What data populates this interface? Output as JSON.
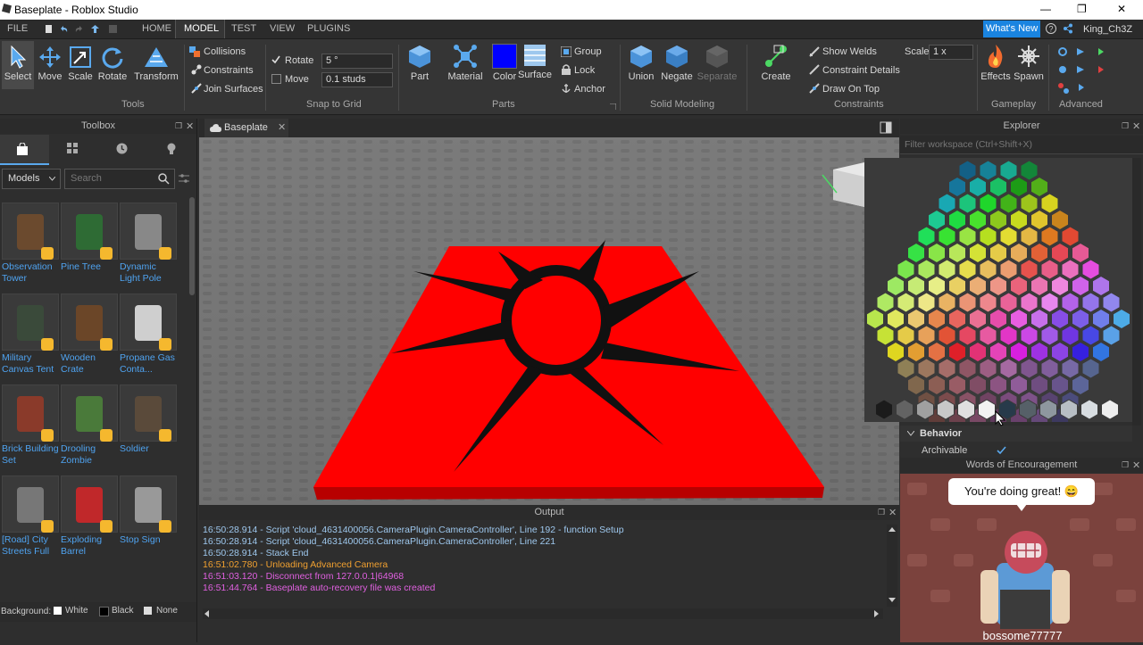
{
  "window": {
    "title": "Baseplate - Roblox Studio",
    "controls": [
      "—",
      "❐",
      "✕"
    ]
  },
  "menu": {
    "tabs": [
      "FILE",
      "HOME",
      "MODEL",
      "TEST",
      "VIEW",
      "PLUGINS"
    ],
    "active": "MODEL",
    "whats_new": "What's New",
    "username": "King_Ch3Z"
  },
  "ribbon": {
    "tools": {
      "items": [
        "Select",
        "Move",
        "Scale",
        "Rotate",
        "Transform"
      ],
      "group": "Tools"
    },
    "collisions": {
      "items": [
        "Collisions",
        "Constraints",
        "Join Surfaces"
      ]
    },
    "snap": {
      "rotate_label": "Rotate",
      "rotate_value": "5 °",
      "move_label": "Move",
      "move_value": "0.1 studs",
      "group": "Snap to Grid"
    },
    "parts": {
      "items": [
        "Part",
        "Material",
        "Color",
        "Surface"
      ],
      "group": "Parts",
      "color_hex": "#0000ff"
    },
    "group_lock": {
      "items": [
        "Group",
        "Lock",
        "Anchor"
      ]
    },
    "solid": {
      "items": [
        "Union",
        "Negate",
        "Separate"
      ],
      "group": "Solid Modeling"
    },
    "create": {
      "label": "Create"
    },
    "constraints": {
      "items": [
        "Show Welds",
        "Constraint Details",
        "Draw On Top"
      ],
      "scale_label": "Scale",
      "scale_value": "1 x",
      "group": "Constraints"
    },
    "gameplay": {
      "items": [
        "Effects",
        "Spawn"
      ],
      "group": "Gameplay"
    },
    "advanced": {
      "group": "Advanced"
    }
  },
  "toolbox": {
    "title": "Toolbox",
    "category": "Models",
    "search_placeholder": "Search",
    "models": [
      "Observation Tower",
      "Pine Tree",
      "Dynamic Light Pole",
      "Military Canvas Tent",
      "Wooden Crate",
      "Propane Gas Conta...",
      "Brick Building Set",
      "Drooling Zombie",
      "Soldier",
      "[Road] City Streets Full",
      "Exploding Barrel",
      "Stop Sign"
    ],
    "background_label": "Background:",
    "background_options": [
      "White",
      "Black",
      "None"
    ]
  },
  "viewport": {
    "tab": "Baseplate",
    "part_color": "#ff0000",
    "decal_color": "#111111"
  },
  "output": {
    "title": "Output",
    "lines": [
      {
        "text": "16:50:28.914 - Script 'cloud_4631400056.CameraPlugin.CameraController', Line 192 - function Setup",
        "color": "#9ec8ee"
      },
      {
        "text": "16:50:28.914 - Script 'cloud_4631400056.CameraPlugin.CameraController', Line 221",
        "color": "#9ec8ee"
      },
      {
        "text": "16:50:28.914 - Stack End",
        "color": "#9ec8ee"
      },
      {
        "text": "16:51:02.780 - Unloading Advanced Camera",
        "color": "#f0a030"
      },
      {
        "text": "16:51:03.120 - Disconnect from 127.0.0.1|64968",
        "color": "#e060e0"
      },
      {
        "text": "16:51:44.764 - Baseplate auto-recovery file was created",
        "color": "#e060e0"
      }
    ]
  },
  "explorer": {
    "title": "Explorer",
    "filter_placeholder": "Filter workspace (Ctrl+Shift+X)",
    "behavior": "Behavior",
    "archivable": "Archivable"
  },
  "encourage": {
    "title": "Words of Encouragement",
    "message": "You're doing great! 😄",
    "username": "bossome77777"
  }
}
